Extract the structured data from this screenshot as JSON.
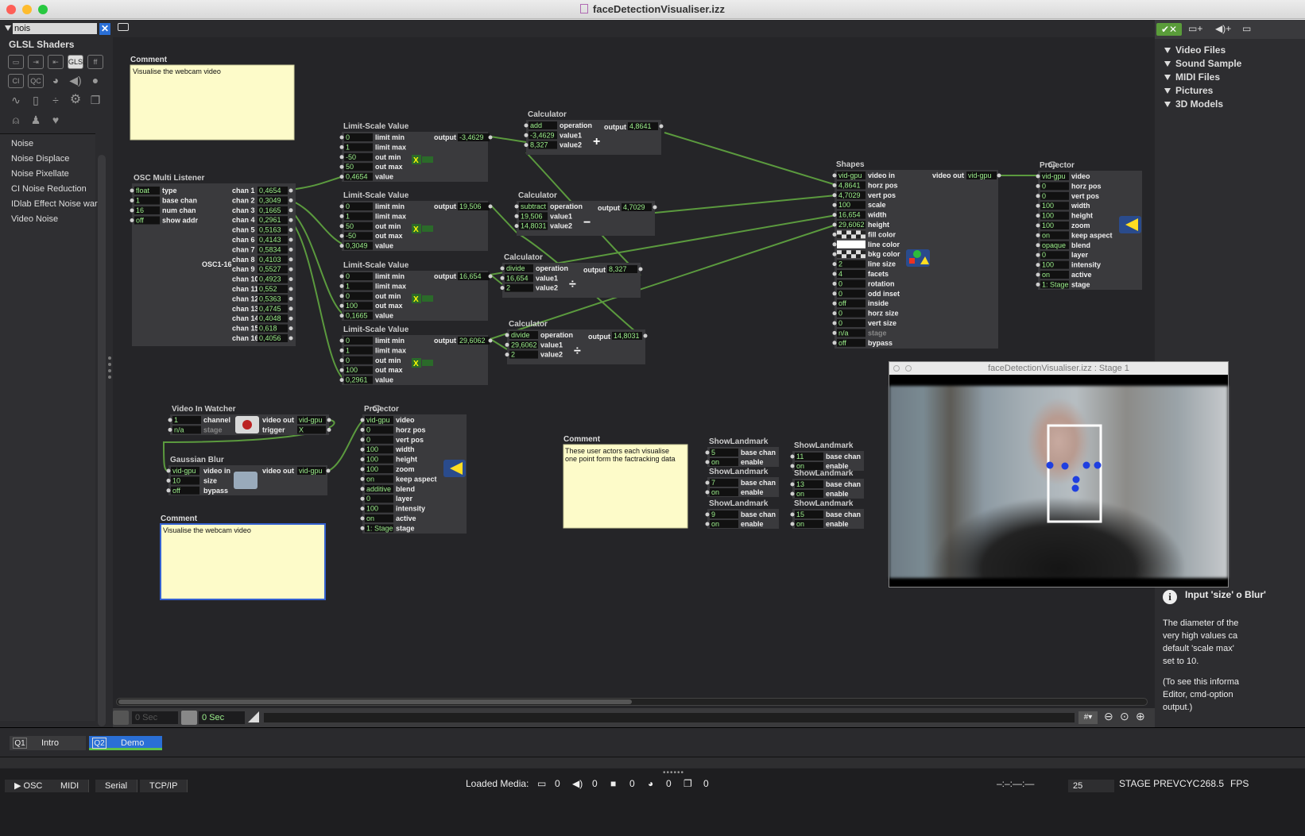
{
  "window": {
    "title": "faceDetectionVisualiser.izz"
  },
  "library": {
    "search_value": "nois",
    "header": "GLSL Shaders",
    "icon_labels": [
      "CI",
      "QC",
      "GLSL",
      "ff"
    ],
    "items": [
      "Noise",
      "Noise Displace",
      "Noise Pixellate",
      "CI Noise Reduction",
      "IDlab Effect Noise war",
      "Video Noise"
    ]
  },
  "right_panel": {
    "sections": [
      "Video Files",
      "Sound Sample",
      "MIDI Files",
      "Pictures",
      "3D Models"
    ],
    "help_title": "Input 'size' o Blur'",
    "help_body_lines": [
      "The diameter of the",
      "very high values ca",
      "default 'scale max'",
      "set to 10."
    ],
    "help_note_lines": [
      "(To see this informa",
      "Editor, cmd-option",
      "output.)"
    ]
  },
  "timebar": {
    "time1": "0 Sec",
    "time2": "0 Sec"
  },
  "scenes": [
    {
      "num": "Q1",
      "label": "Intro"
    },
    {
      "num": "Q2",
      "label": "Demo"
    }
  ],
  "bottom": {
    "buttons": [
      "OSC",
      "MIDI",
      "Serial",
      "TCP/IP"
    ],
    "loaded_media_label": "Loaded Media:",
    "media_counts": [
      "0",
      "0",
      "0",
      "0",
      "0"
    ],
    "rate": "25",
    "stage_prev": "STAGE PREV",
    "cyc_label": "CYC",
    "cyc_value": "268.5",
    "fps_label": "FPS"
  },
  "stage_window": {
    "title": "faceDetectionVisualiser.izz : Stage 1"
  },
  "patch": {
    "comment1": {
      "title": "Comment",
      "text": "Visualise the webcam video"
    },
    "comment2": {
      "title": "Comment",
      "text": "Visualise the webcam video"
    },
    "comment3": {
      "title": "Comment",
      "text_lines": [
        "These user actors each visualise",
        "one point form the factracking data"
      ]
    },
    "osc": {
      "title": "OSC Multi Listener",
      "inputs": [
        {
          "value": "float",
          "label": "type"
        },
        {
          "value": "1",
          "label": "base chan"
        },
        {
          "value": "16",
          "label": "num chan"
        },
        {
          "value": "off",
          "label": "show addr"
        }
      ],
      "outputs": [
        {
          "label": "chan 1",
          "value": "0,4654"
        },
        {
          "label": "chan 2",
          "value": "0,3049"
        },
        {
          "label": "chan 3",
          "value": "0,1665"
        },
        {
          "label": "chan 4",
          "value": "0,2961"
        },
        {
          "label": "chan 5",
          "value": "0,5163"
        },
        {
          "label": "chan 6",
          "value": "0,4143"
        },
        {
          "label": "chan 7",
          "value": "0,5834"
        },
        {
          "label": "chan 8",
          "value": "0,4103"
        },
        {
          "label": "chan 9",
          "value": "0,5527"
        },
        {
          "label": "chan 10",
          "value": "0,4923"
        },
        {
          "label": "chan 11",
          "value": "0,552"
        },
        {
          "label": "chan 12",
          "value": "0,5363"
        },
        {
          "label": "chan 13",
          "value": "0,4745"
        },
        {
          "label": "chan 14",
          "value": "0,4048"
        },
        {
          "label": "chan 15",
          "value": "0,618"
        },
        {
          "label": "chan 16",
          "value": "0,4056"
        }
      ],
      "icon_label": "OSC1-16"
    },
    "scalers": [
      {
        "title": "Limit-Scale Value",
        "rows": [
          {
            "value": "0",
            "label": "limit min"
          },
          {
            "value": "1",
            "label": "limit max"
          },
          {
            "value": "-50",
            "label": "out min"
          },
          {
            "value": "50",
            "label": "out max"
          },
          {
            "value": "0,4654",
            "label": "value"
          }
        ],
        "output_label": "output",
        "output": "-3,4629"
      },
      {
        "title": "Limit-Scale Value",
        "rows": [
          {
            "value": "0",
            "label": "limit min"
          },
          {
            "value": "1",
            "label": "limit max"
          },
          {
            "value": "50",
            "label": "out min"
          },
          {
            "value": "-50",
            "label": "out max"
          },
          {
            "value": "0,3049",
            "label": "value"
          }
        ],
        "output_label": "output",
        "output": "19,506"
      },
      {
        "title": "Limit-Scale Value",
        "rows": [
          {
            "value": "0",
            "label": "limit min"
          },
          {
            "value": "1",
            "label": "limit max"
          },
          {
            "value": "0",
            "label": "out min"
          },
          {
            "value": "100",
            "label": "out max"
          },
          {
            "value": "0,1665",
            "label": "value"
          }
        ],
        "output_label": "output",
        "output": "16,654"
      },
      {
        "title": "Limit-Scale Value",
        "rows": [
          {
            "value": "0",
            "label": "limit min"
          },
          {
            "value": "1",
            "label": "limit max"
          },
          {
            "value": "0",
            "label": "out min"
          },
          {
            "value": "100",
            "label": "out max"
          },
          {
            "value": "0,2961",
            "label": "value"
          }
        ],
        "output_label": "output",
        "output": "29,6062"
      }
    ],
    "calcs": [
      {
        "title": "Calculator",
        "op": "add",
        "v1": "-3,4629",
        "v2": "8,327",
        "output": "4,8641",
        "symbol": "+"
      },
      {
        "title": "Calculator",
        "op": "subtract",
        "v1": "19,506",
        "v2": "14,8031",
        "output": "4,7029",
        "symbol": "−"
      },
      {
        "title": "Calculator",
        "op": "divide",
        "v1": "16,654",
        "v2": "2",
        "output": "8,327",
        "symbol": "÷"
      },
      {
        "title": "Calculator",
        "op": "divide",
        "v1": "29,6062",
        "v2": "2",
        "output": "14,8031",
        "symbol": "÷"
      }
    ],
    "calc_labels": {
      "operation": "operation",
      "value1": "value1",
      "value2": "value2",
      "output": "output"
    },
    "shapes": {
      "title": "Shapes",
      "rows": [
        {
          "value": "vid-gpu",
          "label": "video in"
        },
        {
          "value": "4,8641",
          "label": "horz pos"
        },
        {
          "value": "4,7029",
          "label": "vert pos"
        },
        {
          "value": "100",
          "label": "scale"
        },
        {
          "value": "16,654",
          "label": "width"
        },
        {
          "value": "29,6062",
          "label": "height"
        },
        {
          "value": "",
          "label": "fill color"
        },
        {
          "value": "",
          "label": "line color"
        },
        {
          "value": "",
          "label": "bkg color"
        },
        {
          "value": "2",
          "label": "line size"
        },
        {
          "value": "4",
          "label": "facets"
        },
        {
          "value": "0",
          "label": "rotation"
        },
        {
          "value": "0",
          "label": "odd inset"
        },
        {
          "value": "off",
          "label": "inside"
        },
        {
          "value": "0",
          "label": "horz size"
        },
        {
          "value": "0",
          "label": "vert size"
        },
        {
          "value": "n/a",
          "label": "stage"
        },
        {
          "value": "off",
          "label": "bypass"
        }
      ],
      "out_label": "video out",
      "out_value": "vid-gpu"
    },
    "projector1": {
      "title": "Projector",
      "rows": [
        {
          "value": "vid-gpu",
          "label": "video"
        },
        {
          "value": "0",
          "label": "horz pos"
        },
        {
          "value": "0",
          "label": "vert pos"
        },
        {
          "value": "100",
          "label": "width"
        },
        {
          "value": "100",
          "label": "height"
        },
        {
          "value": "100",
          "label": "zoom"
        },
        {
          "value": "on",
          "label": "keep aspect"
        },
        {
          "value": "opaque",
          "label": "blend"
        },
        {
          "value": "0",
          "label": "layer"
        },
        {
          "value": "100",
          "label": "intensity"
        },
        {
          "value": "on",
          "label": "active"
        },
        {
          "value": "1: Stage",
          "label": "stage"
        }
      ]
    },
    "projector2": {
      "title": "Projector",
      "rows": [
        {
          "value": "vid-gpu",
          "label": "video"
        },
        {
          "value": "0",
          "label": "horz pos"
        },
        {
          "value": "0",
          "label": "vert pos"
        },
        {
          "value": "100",
          "label": "width"
        },
        {
          "value": "100",
          "label": "height"
        },
        {
          "value": "100",
          "label": "zoom"
        },
        {
          "value": "on",
          "label": "keep aspect"
        },
        {
          "value": "additive",
          "label": "blend"
        },
        {
          "value": "0",
          "label": "layer"
        },
        {
          "value": "100",
          "label": "intensity"
        },
        {
          "value": "on",
          "label": "active"
        },
        {
          "value": "1: Stage",
          "label": "stage"
        }
      ]
    },
    "video_watcher": {
      "title": "Video In Watcher",
      "rows": [
        {
          "value": "1",
          "label": "channel"
        },
        {
          "value": "n/a",
          "label": "stage"
        }
      ],
      "outs": [
        {
          "label": "video out",
          "value": "vid-gpu"
        },
        {
          "label": "trigger",
          "value": "X"
        }
      ]
    },
    "gauss": {
      "title": "Gaussian Blur",
      "rows": [
        {
          "value": "vid-gpu",
          "label": "video in"
        },
        {
          "value": "10",
          "label": "size"
        },
        {
          "value": "off",
          "label": "bypass"
        }
      ],
      "out_label": "video out",
      "out_value": "vid-gpu"
    },
    "landmarks": [
      {
        "title": "ShowLandmark",
        "chan": "5",
        "enable": "on"
      },
      {
        "title": "ShowLandmark",
        "chan": "7",
        "enable": "on"
      },
      {
        "title": "ShowLandmark",
        "chan": "9",
        "enable": "on"
      },
      {
        "title": "ShowLandmark",
        "chan": "11",
        "enable": "on"
      },
      {
        "title": "ShowLandmark",
        "chan": "13",
        "enable": "on"
      },
      {
        "title": "ShowLandmark",
        "chan": "15",
        "enable": "on"
      }
    ],
    "landmark_labels": {
      "chan": "base chan",
      "enable": "enable"
    }
  },
  "colors": {
    "wire": "#5b9a3e",
    "value_text": "#9cf08b",
    "accent": "#2a6fd6",
    "stage_dots": "#1f3fe0"
  },
  "icons": [
    "search-icon",
    "camera-icon",
    "plus-icon",
    "minus-icon",
    "divide-icon",
    "eye-icon",
    "projector-icon",
    "info-icon",
    "zoom-in-icon",
    "zoom-out-icon"
  ]
}
